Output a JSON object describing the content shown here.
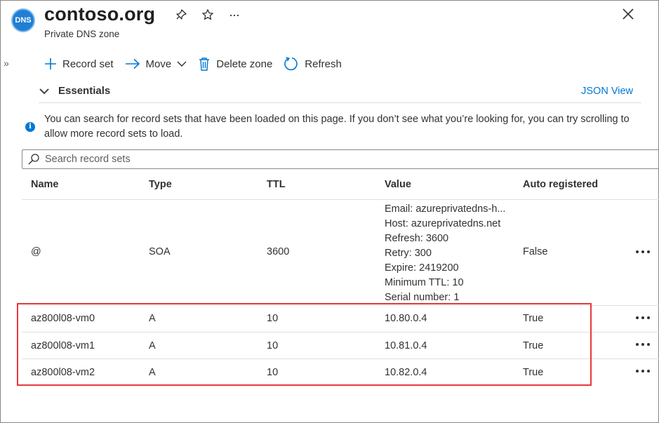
{
  "header": {
    "logo_text": "DNS",
    "title": "contoso.org",
    "subtitle": "Private DNS zone"
  },
  "toolbar": {
    "record_set": "Record set",
    "move": "Move",
    "delete_zone": "Delete zone",
    "refresh": "Refresh"
  },
  "essentials": {
    "label": "Essentials",
    "json_view": "JSON View"
  },
  "info": {
    "text": "You can search for record sets that have been loaded on this page. If you don’t see what you’re looking for, you can try scrolling to allow more record sets to load."
  },
  "search": {
    "placeholder": "Search record sets"
  },
  "table": {
    "columns": [
      "Name",
      "Type",
      "TTL",
      "Value",
      "Auto registered"
    ],
    "rows": [
      {
        "name": "@",
        "type": "SOA",
        "ttl": "3600",
        "value_lines": [
          "Email: azureprivatedns-h...",
          "Host: azureprivatedns.net",
          "Refresh: 3600",
          "Retry: 300",
          "Expire: 2419200",
          "Minimum TTL: 10",
          "Serial number: 1"
        ],
        "auto": "False"
      },
      {
        "name": "az800l08-vm0",
        "type": "A",
        "ttl": "10",
        "value": "10.80.0.4",
        "auto": "True"
      },
      {
        "name": "az800l08-vm1",
        "type": "A",
        "ttl": "10",
        "value": "10.81.0.4",
        "auto": "True"
      },
      {
        "name": "az800l08-vm2",
        "type": "A",
        "ttl": "10",
        "value": "10.82.0.4",
        "auto": "True"
      }
    ]
  },
  "colors": {
    "accent": "#0078d4",
    "highlight": "#e8383d"
  }
}
